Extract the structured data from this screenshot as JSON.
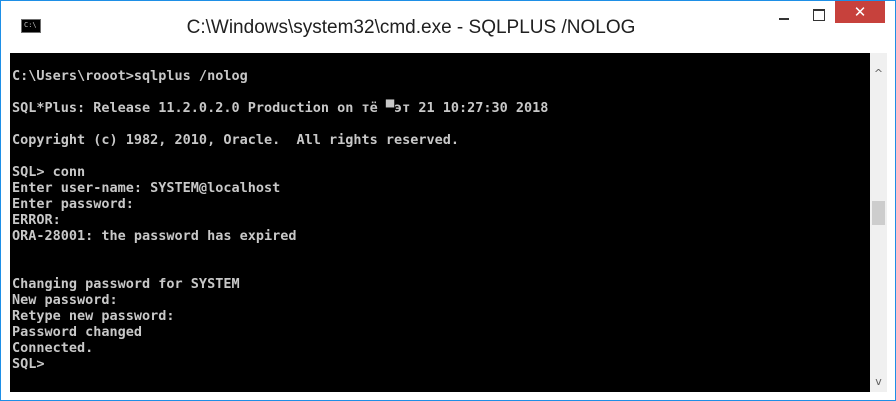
{
  "window": {
    "title": "C:\\Windows\\system32\\cmd.exe - SQLPLUS  /NOLOG",
    "app_icon_label": "C:\\",
    "minimize_glyph": "—",
    "maximize_glyph": "□",
    "close_glyph": "✕"
  },
  "console": {
    "lines": [
      "C:\\Users\\rooot>sqlplus /nolog",
      "",
      "SQL*Plus: Release 11.2.0.2.0 Production on тё ▀эт 21 10:27:30 2018",
      "",
      "Copyright (c) 1982, 2010, Oracle.  All rights reserved.",
      "",
      "SQL> conn",
      "Enter user-name: SYSTEM@localhost",
      "Enter password:",
      "ERROR:",
      "ORA-28001: the password has expired",
      "",
      "",
      "Changing password for SYSTEM",
      "New password:",
      "Retype new password:",
      "Password changed",
      "Connected.",
      "SQL>"
    ]
  },
  "scrollbar": {
    "up_arrow": "^",
    "down_arrow": "v"
  },
  "colors": {
    "console_background": "#000000",
    "console_text": "#c8c8c8",
    "close_button": "#c7413c",
    "window_border": "#1e8fe6"
  }
}
